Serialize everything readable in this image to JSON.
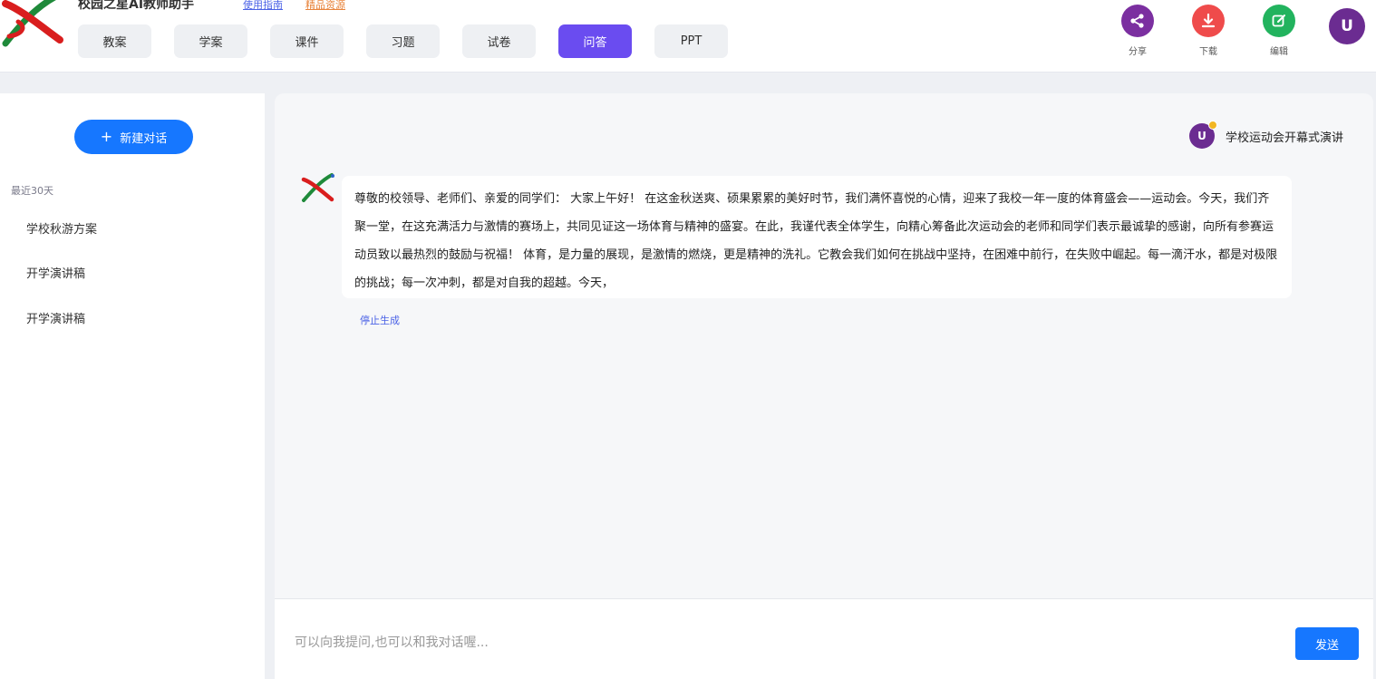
{
  "header": {
    "app_title": "校园之星AI教师助手",
    "links": {
      "guide": "使用指南",
      "resources": "精品资源"
    },
    "tabs": [
      {
        "label": "教案",
        "active": false
      },
      {
        "label": "学案",
        "active": false
      },
      {
        "label": "课件",
        "active": false
      },
      {
        "label": "习题",
        "active": false
      },
      {
        "label": "试卷",
        "active": false
      },
      {
        "label": "问答",
        "active": true
      },
      {
        "label": "PPT",
        "active": false
      }
    ],
    "actions": {
      "share": {
        "label": "分享",
        "icon": "share-icon",
        "color": "#7b2fa0"
      },
      "download": {
        "label": "下载",
        "icon": "download-icon",
        "color": "#ef4b4b"
      },
      "edit": {
        "label": "编辑",
        "icon": "edit-icon",
        "color": "#22b35e"
      }
    },
    "avatar_letter": "U"
  },
  "sidebar": {
    "new_chat_label": "新建对话",
    "recent_label": "最近30天",
    "history": [
      "学校秋游方案",
      "开学演讲稿",
      "开学演讲稿"
    ]
  },
  "chat": {
    "user_avatar_letter": "U",
    "user_question": "学校运动会开幕式演讲",
    "bot_answer": "尊敬的校领导、老师们、亲爱的同学们：  大家上午好！  在这金秋送爽、硕果累累的美好时节，我们满怀喜悦的心情，迎来了我校一年一度的体育盛会——运动会。今天，我们齐聚一堂，在这充满活力与激情的赛场上，共同见证这一场体育与精神的盛宴。在此，我谨代表全体学生，向精心筹备此次运动会的老师和同学们表示最诚挚的感谢，向所有参赛运动员致以最热烈的鼓励与祝福！  体育，是力量的展现，是激情的燃烧，更是精神的洗礼。它教会我们如何在挑战中坚持，在困难中前行，在失败中崛起。每一滴汗水，都是对极限的挑战；每一次冲刺，都是对自我的超越。今天，",
    "stop_label": "停止生成"
  },
  "input": {
    "placeholder": "可以向我提问,也可以和我对话喔...",
    "value": "",
    "send_label": "发送"
  },
  "colors": {
    "accent": "#1677ff",
    "active_tab": "#6a4cf0",
    "avatar": "#6b2c91"
  }
}
